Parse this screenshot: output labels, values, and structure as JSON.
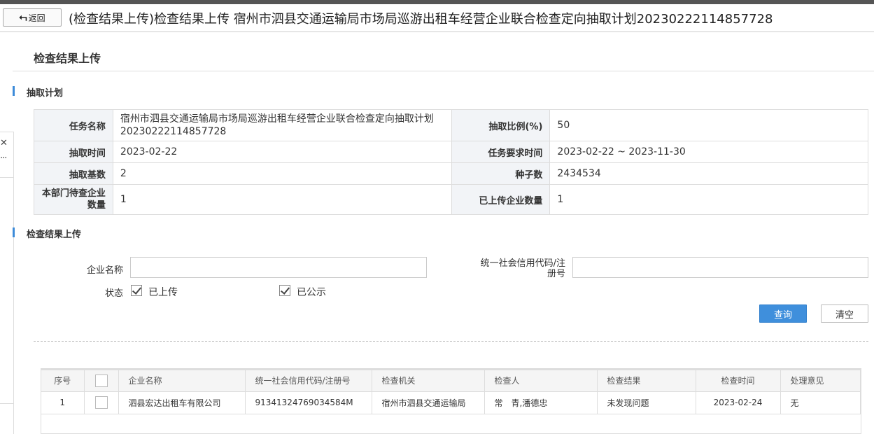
{
  "window": {
    "back_label": "返回",
    "title": "(检查结果上传)检查结果上传 宿州市泗县交通运输局市场局巡游出租车经营企业联合检查定向抽取计划20230222114857728"
  },
  "page": {
    "heading": "检查结果上传"
  },
  "plan_section": {
    "title": "抽取计划",
    "rows": [
      {
        "l1": "任务名称",
        "v1": "宿州市泗县交通运输局市场局巡游出租车经营企业联合检查定向抽取计划20230222114857728",
        "l2": "抽取比例(%)",
        "v2": "50"
      },
      {
        "l1": "抽取时间",
        "v1": "2023-02-22",
        "l2": "任务要求时间",
        "v2": "2023-02-22 ~ 2023-11-30"
      },
      {
        "l1": "抽取基数",
        "v1": "2",
        "l2": "种子数",
        "v2": "2434534"
      },
      {
        "l1": "本部门待查企业数量",
        "v1": "1",
        "l2": "已上传企业数量",
        "v2": "1"
      }
    ]
  },
  "upload_section": {
    "title": "检查结果上传",
    "company_name_label": "企业名称",
    "company_name_value": "",
    "credit_code_label": "统一社会信用代码/注册号",
    "credit_code_value": "",
    "status_label": "状态",
    "status_options": [
      {
        "label": "已上传",
        "checked": true
      },
      {
        "label": "已公示",
        "checked": true
      }
    ],
    "query_button": "查询",
    "clear_button": "清空"
  },
  "results": {
    "columns": [
      "序号",
      "",
      "企业名称",
      "统一社会信用代码/注册号",
      "检查机关",
      "检查人",
      "检查结果",
      "检查时间",
      "处理意见"
    ],
    "rows": [
      [
        "1",
        "",
        "泗县宏达出租车有限公司",
        "91341324769034584M",
        "宿州市泗县交通运输局",
        "常　青,潘德忠",
        "未发现问题",
        "2023-02-24",
        "无"
      ]
    ]
  },
  "colors": {
    "accent": "#3f8fdc",
    "label_bg": "#f2f4f7"
  }
}
